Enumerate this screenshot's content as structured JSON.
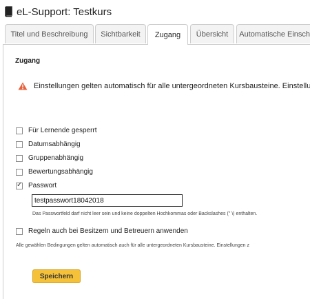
{
  "header": {
    "title": "eL-Support: Testkurs",
    "icon": "book-icon"
  },
  "tabs": [
    {
      "label": "Titel und Beschreibung",
      "active": false
    },
    {
      "label": "Sichtbarkeit",
      "active": false
    },
    {
      "label": "Zugang",
      "active": true
    },
    {
      "label": "Übersicht",
      "active": false
    },
    {
      "label": "Automatische Einschr",
      "active": false
    }
  ],
  "section": {
    "title": "Zugang"
  },
  "warning": {
    "text": "Einstellungen gelten automatisch für alle untergeordneten Kursbausteine. Einstellun"
  },
  "options": [
    {
      "label": "Für Lernende gesperrt",
      "checked": false
    },
    {
      "label": "Datumsabhängig",
      "checked": false
    },
    {
      "label": "Gruppenabhängig",
      "checked": false
    },
    {
      "label": "Bewertungsabhängig",
      "checked": false
    },
    {
      "label": "Passwort",
      "checked": true
    }
  ],
  "password": {
    "value": "testpasswort18042018",
    "hint": "Das Passwortfeld darf nicht leer sein und keine doppelten Hochkommas oder Backslashes (\" \\) enthalten."
  },
  "owner_option": {
    "label": "Regeln auch bei Besitzern und Betreuern anwenden",
    "checked": false
  },
  "footer_note": "Alle gewählen Bedingungen gelten automatisch auch für alle untergeordneten Kursbausteine. Einstellungen z",
  "save_button": {
    "label": "Speichern"
  },
  "colors": {
    "accent": "#f4c138",
    "warning": "#e8603c"
  }
}
